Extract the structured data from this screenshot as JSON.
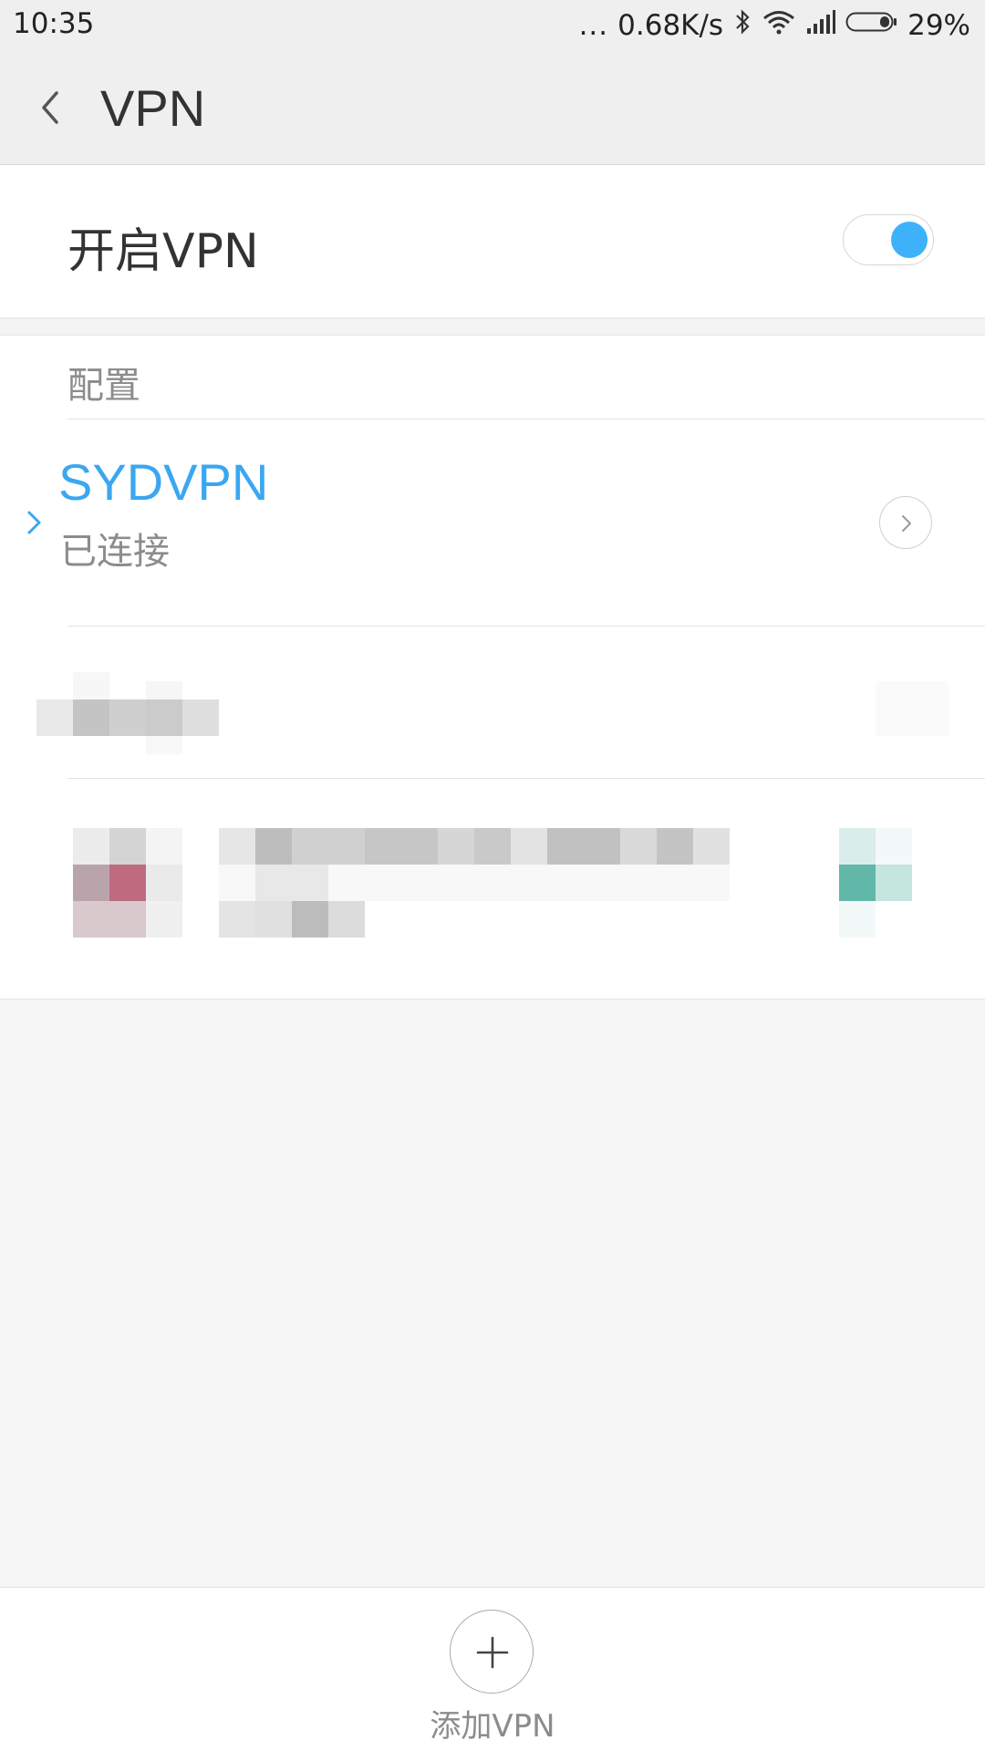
{
  "status_bar": {
    "time": "10:35",
    "dots": "...",
    "net_speed": "0.68K/s",
    "battery_pct": "29%",
    "icons": [
      "bluetooth-icon",
      "wifi-icon",
      "signal-icon",
      "battery-icon"
    ]
  },
  "header": {
    "title": "VPN",
    "back_icon": "back-chevron-icon"
  },
  "toggle": {
    "label": "开启VPN",
    "state": "on",
    "accent": "#3db2fb"
  },
  "section": {
    "label": "配置"
  },
  "vpn_list": [
    {
      "name": "SYDVPN",
      "status": "已连接",
      "active": true,
      "name_color": "#3aa7f0"
    }
  ],
  "bottom": {
    "add_label": "添加VPN",
    "add_icon": "plus-icon"
  }
}
